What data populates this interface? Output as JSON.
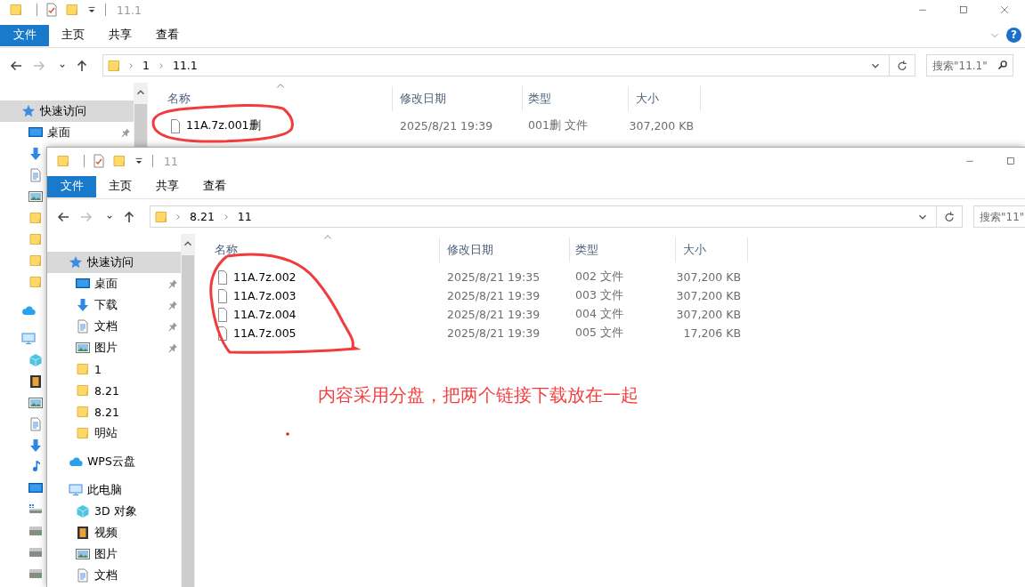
{
  "back_window": {
    "title": "11.1",
    "window_controls": [
      {
        "kind": "minimize"
      },
      {
        "kind": "maximize"
      },
      {
        "kind": "close"
      }
    ],
    "ribbon_tabs": [
      {
        "label": "文件",
        "kind": "file"
      },
      {
        "label": "主页",
        "kind": "tab"
      },
      {
        "label": "共享",
        "kind": "tab"
      },
      {
        "label": "查看",
        "kind": "tab"
      }
    ],
    "help_button": {
      "label": "?"
    },
    "nav": [
      {
        "kind": "back",
        "disabled": false
      },
      {
        "kind": "forward",
        "disabled": true
      },
      {
        "kind": "recent",
        "disabled": false
      },
      {
        "kind": "up",
        "disabled": false
      }
    ],
    "breadcrumb": [
      "1",
      "11.1"
    ],
    "search": {
      "placeholder": "搜索\"11.1\"",
      "magnifier": true
    },
    "sidebar": {
      "items": [
        {
          "kind": "star",
          "label": "快速访问",
          "selected": true,
          "children": [
            {
              "kind": "desktop",
              "label": "桌面",
              "pinned": true,
              "selected": false
            },
            {
              "kind": "download",
              "selected": false
            },
            {
              "kind": "document",
              "selected": false
            },
            {
              "kind": "pictures",
              "selected": false
            },
            {
              "kind": "folder",
              "selected": false
            },
            {
              "kind": "folder",
              "selected": false
            },
            {
              "kind": "folder",
              "selected": false
            },
            {
              "kind": "folder",
              "selected": false
            }
          ]
        },
        {
          "kind": "cloud",
          "selected": false
        },
        {
          "kind": "computer",
          "selected": false,
          "children": [
            {
              "kind": "cube",
              "selected": false
            },
            {
              "kind": "video",
              "selected": false
            },
            {
              "kind": "pictures",
              "selected": false
            },
            {
              "kind": "document",
              "selected": false
            },
            {
              "kind": "download",
              "selected": false
            },
            {
              "kind": "music",
              "selected": false
            },
            {
              "kind": "desktop",
              "selected": false
            },
            {
              "kind": "system-drive",
              "selected": false
            },
            {
              "kind": "drive",
              "selected": false
            },
            {
              "kind": "drive",
              "selected": false
            },
            {
              "kind": "drive",
              "selected": false
            }
          ]
        }
      ]
    },
    "columns": [
      "名称",
      "修改日期",
      "类型",
      "大小"
    ],
    "rows": [
      {
        "name": "11A.7z.001删",
        "modified": "2025/8/21 19:39",
        "type": "001删 文件",
        "size": "307,200 KB"
      }
    ]
  },
  "front_window": {
    "title": "11",
    "window_controls": [
      {
        "kind": "minimize"
      },
      {
        "kind": "maximize"
      }
    ],
    "ribbon_tabs": [
      {
        "label": "文件",
        "kind": "file"
      },
      {
        "label": "主页",
        "kind": "tab"
      },
      {
        "label": "共享",
        "kind": "tab"
      },
      {
        "label": "查看",
        "kind": "tab"
      }
    ],
    "nav": [
      {
        "kind": "back",
        "disabled": false
      },
      {
        "kind": "forward",
        "disabled": true
      },
      {
        "kind": "recent",
        "disabled": false
      },
      {
        "kind": "up",
        "disabled": false
      }
    ],
    "breadcrumb": [
      "8.21",
      "11"
    ],
    "search": {
      "placeholder": "搜索\"11\""
    },
    "sidebar": {
      "items": [
        {
          "kind": "star",
          "label": "快速访问",
          "selected": true,
          "children": [
            {
              "kind": "desktop",
              "label": "桌面",
              "pinned": true,
              "selected": false
            },
            {
              "kind": "download",
              "label": "下载",
              "pinned": true,
              "selected": false
            },
            {
              "kind": "document",
              "label": "文档",
              "pinned": true,
              "selected": false
            },
            {
              "kind": "pictures",
              "label": "图片",
              "pinned": true,
              "selected": false
            },
            {
              "kind": "folder",
              "label": "1",
              "selected": false
            },
            {
              "kind": "folder",
              "label": "8.21",
              "selected": false
            },
            {
              "kind": "folder",
              "label": "8.21",
              "selected": false
            },
            {
              "kind": "folder",
              "label": "明站",
              "selected": false
            }
          ]
        },
        {
          "kind": "cloud",
          "label": "WPS云盘",
          "selected": false
        },
        {
          "kind": "computer",
          "label": "此电脑",
          "selected": false,
          "children": [
            {
              "kind": "cube",
              "label": "3D 对象",
              "selected": false
            },
            {
              "kind": "video",
              "label": "视频",
              "selected": false
            },
            {
              "kind": "pictures",
              "label": "图片",
              "selected": false
            },
            {
              "kind": "document",
              "label": "文档",
              "selected": false
            }
          ]
        }
      ]
    },
    "columns": [
      "名称",
      "修改日期",
      "类型",
      "大小"
    ],
    "rows": [
      {
        "name": "11A.7z.002",
        "modified": "2025/8/21 19:35",
        "type": "002 文件",
        "size": "307,200 KB"
      },
      {
        "name": "11A.7z.003",
        "modified": "2025/8/21 19:39",
        "type": "003 文件",
        "size": "307,200 KB"
      },
      {
        "name": "11A.7z.004",
        "modified": "2025/8/21 19:39",
        "type": "004 文件",
        "size": "307,200 KB"
      },
      {
        "name": "11A.7z.005",
        "modified": "2025/8/21 19:39",
        "type": "005 文件",
        "size": "17,206 KB"
      }
    ]
  },
  "annotation": {
    "text": "内容采用分盘，把两个链接下载放在一起"
  }
}
